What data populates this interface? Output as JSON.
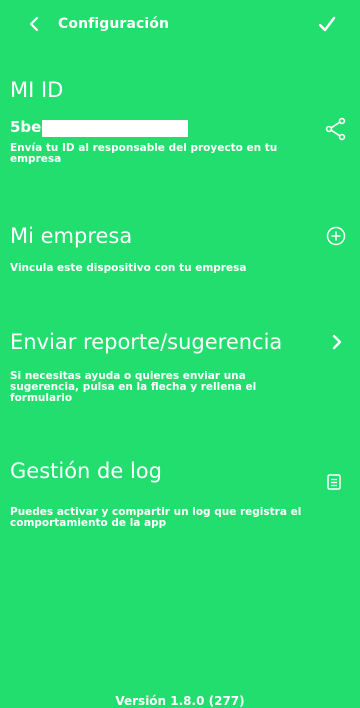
{
  "header": {
    "title": "Configuración"
  },
  "my_id": {
    "title": "MI ID",
    "value": "5be",
    "description": "Envía tu ID al responsable del proyecto en tu empresa"
  },
  "company": {
    "title": "Mi empresa",
    "description": "Vincula este dispositivo con tu empresa"
  },
  "report": {
    "title": "Enviar reporte/sugerencia",
    "description": "Si necesitas ayuda o quieres enviar una sugerencia, pulsa en la flecha y rellena el formulario"
  },
  "log": {
    "title": "Gestión de log",
    "description": "Puedes activar y compartir un log que registra el comportamiento de la app"
  },
  "footer": {
    "version": "Versión 1.8.0 (277)"
  },
  "colors": {
    "background": "#22DE6E",
    "foreground": "#FFFFFF"
  },
  "icons": {
    "back": "chevron-left-icon",
    "confirm": "check-icon",
    "share": "share-icon",
    "add": "add-circle-icon",
    "forward": "chevron-right-icon",
    "log": "document-icon"
  }
}
